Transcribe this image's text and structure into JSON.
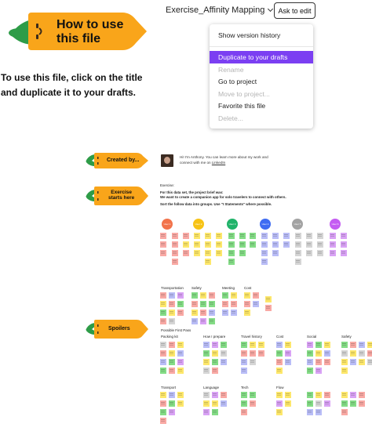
{
  "header": {
    "file_title": "Exercise_Affinity Mapping",
    "ask_to_edit": "Ask to edit"
  },
  "banner": {
    "line1": "How to use",
    "line2": "this file"
  },
  "menu": {
    "items": [
      {
        "label": "Show version history",
        "state": "normal"
      },
      {
        "label": "Duplicate to your drafts",
        "state": "active"
      },
      {
        "label": "Rename",
        "state": "disabled"
      },
      {
        "label": "Go to project",
        "state": "normal"
      },
      {
        "label": "Move to project...",
        "state": "disabled"
      },
      {
        "label": "Favorite this file",
        "state": "normal"
      },
      {
        "label": "Delete...",
        "state": "disabled"
      }
    ]
  },
  "instructions": {
    "line1": "To use this file, click on the title",
    "line2": "and duplicate it to your drafts."
  },
  "board": {
    "labels": {
      "created_by": "Created by...",
      "exercise_line1": "Exercise",
      "exercise_line2": "starts here",
      "spoilers": "Spoilers"
    },
    "profile": {
      "line1": "Hi! I'm Anthony. You can learn more about my work and",
      "line2_prefix": "connect with me on ",
      "link": "LinkedIn"
    },
    "brief": {
      "heading": "Exercise:",
      "line1": "For this data set, the project brief was:",
      "line2": "We want to create a companion app for solo travelers to connect with others.",
      "line3": "Sort the follow data into groups. Use \"I Statements\" where possible."
    },
    "users": [
      "User 1",
      "User 2",
      "User 3",
      "User 4",
      "User 5",
      "User 6"
    ],
    "section1_labels": [
      "Transportation",
      "Safety",
      "Meeting",
      "Cost"
    ],
    "first_pass": "Possible First Pass",
    "section2_labels": [
      "Packing kit",
      "How I prepare",
      "Travel history",
      "Cost",
      "Social",
      "Safety"
    ],
    "section3_labels": [
      "Transport",
      "Language",
      "Tech",
      "Flow"
    ]
  },
  "colors": {
    "carrot_orange": "#f9a51a",
    "carrot_leaf": "#2e9c48",
    "accent_purple": "#7b3ff2",
    "dot_colors": [
      "#f2734b",
      "#f7c316",
      "#21b36a",
      "#3f6cf2",
      "#a3a3a3",
      "#c45cf2"
    ],
    "sticky_colors": [
      "#f9a9a4",
      "#fde76b",
      "#84dc86",
      "#b9bdf7",
      "#d5d5d5",
      "#d9a2f5"
    ]
  }
}
